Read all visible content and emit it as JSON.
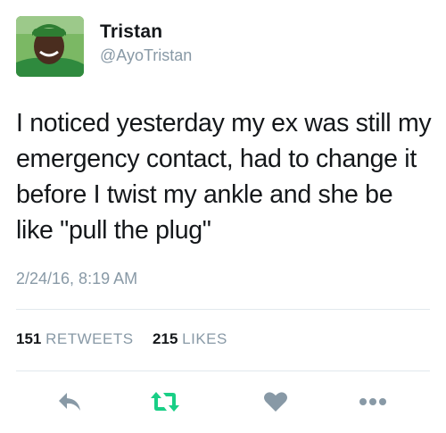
{
  "user": {
    "display_name": "Tristan",
    "handle": "@AyoTristan"
  },
  "tweet": {
    "text": "I noticed yesterday my ex was still my emergency contact, had to change it before I twist my ankle and she be like \"pull the plug\"",
    "timestamp": "2/24/16, 8:19 AM"
  },
  "stats": {
    "retweets_count": "151",
    "retweets_label": "RETWEETS",
    "likes_count": "215",
    "likes_label": "LIKES"
  },
  "actions": [
    {
      "name": "reply",
      "icon": "reply-icon",
      "color": "#8899a6"
    },
    {
      "name": "retweet",
      "icon": "retweet-icon",
      "color": "#19cf86"
    },
    {
      "name": "like",
      "icon": "heart-icon",
      "color": "#8899a6"
    },
    {
      "name": "more",
      "icon": "more-dots-icon",
      "color": "#8899a6"
    }
  ],
  "colors": {
    "text": "#14171a",
    "secondary": "#8899a6",
    "retweet_active": "#19cf86",
    "divider": "#e1e8ed"
  }
}
